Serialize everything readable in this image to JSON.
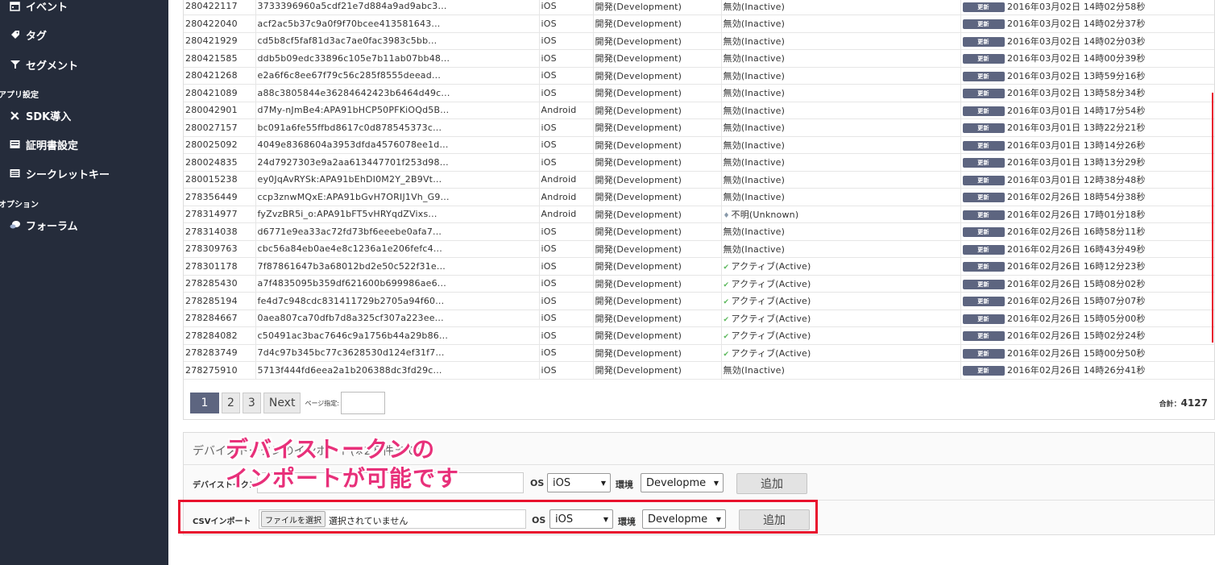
{
  "sidebar": {
    "items": [
      {
        "label": "イベント",
        "icon": "calendar-icon"
      },
      {
        "label": "タグ",
        "icon": "tag-icon"
      },
      {
        "label": "セグメント",
        "icon": "filter-icon"
      },
      {
        "label": "SDK導入",
        "icon": "tools-icon"
      },
      {
        "label": "証明書設定",
        "icon": "certificate-icon"
      },
      {
        "label": "シークレットキー",
        "icon": "key-list-icon"
      },
      {
        "label": "フォーラム",
        "icon": "forum-icon"
      }
    ],
    "sections": [
      "アプリ設定",
      "オプション"
    ]
  },
  "table": {
    "update_label": "更新",
    "rows": [
      {
        "id": "280422117",
        "token": "3733396960a5cdf21e7d884a9ad9abc3...",
        "os": "iOS",
        "env": "開発(Development)",
        "status": "無効(Inactive)",
        "status_type": "inactive",
        "date": "2016年03月02日 14時02分58秒"
      },
      {
        "id": "280422040",
        "token": "acf2ac5b37c9a0f9f70bcee413581643...",
        "os": "iOS",
        "env": "開発(Development)",
        "status": "無効(Inactive)",
        "status_type": "inactive",
        "date": "2016年03月02日 14時02分37秒"
      },
      {
        "id": "280421929",
        "token": "cd5b8cf5faf81d3ac7ae0fac3983c5bb...",
        "os": "iOS",
        "env": "開発(Development)",
        "status": "無効(Inactive)",
        "status_type": "inactive",
        "date": "2016年03月02日 14時02分03秒"
      },
      {
        "id": "280421585",
        "token": "ddb5b09edc33896c105e7b11ab07bb48...",
        "os": "iOS",
        "env": "開発(Development)",
        "status": "無効(Inactive)",
        "status_type": "inactive",
        "date": "2016年03月02日 14時00分39秒"
      },
      {
        "id": "280421268",
        "token": "e2a6f6c8ee67f79c56c285f8555deead...",
        "os": "iOS",
        "env": "開発(Development)",
        "status": "無効(Inactive)",
        "status_type": "inactive",
        "date": "2016年03月02日 13時59分16秒"
      },
      {
        "id": "280421089",
        "token": "a88c3805844e36284642423b6464d49c...",
        "os": "iOS",
        "env": "開発(Development)",
        "status": "無効(Inactive)",
        "status_type": "inactive",
        "date": "2016年03月02日 13時58分34秒"
      },
      {
        "id": "280042901",
        "token": "d7My-nJmBe4:APA91bHCP50PFKiOQd5B...",
        "os": "Android",
        "env": "開発(Development)",
        "status": "無効(Inactive)",
        "status_type": "inactive",
        "date": "2016年03月01日 14時17分54秒"
      },
      {
        "id": "280027157",
        "token": "bc091a6fe55ffbd8617c0d878545373c...",
        "os": "iOS",
        "env": "開発(Development)",
        "status": "無効(Inactive)",
        "status_type": "inactive",
        "date": "2016年03月01日 13時22分21秒"
      },
      {
        "id": "280025092",
        "token": "4049e8368604a3953dfda4576078ee1d...",
        "os": "iOS",
        "env": "開発(Development)",
        "status": "無効(Inactive)",
        "status_type": "inactive",
        "date": "2016年03月01日 13時14分26秒"
      },
      {
        "id": "280024835",
        "token": "24d7927303e9a2aa613447701f253d98...",
        "os": "iOS",
        "env": "開発(Development)",
        "status": "無効(Inactive)",
        "status_type": "inactive",
        "date": "2016年03月01日 13時13分29秒"
      },
      {
        "id": "280015238",
        "token": "ey0JqAvRYSk:APA91bEhDI0M2Y_2B9Vt...",
        "os": "Android",
        "env": "開発(Development)",
        "status": "無効(Inactive)",
        "status_type": "inactive",
        "date": "2016年03月01日 12時38分48秒"
      },
      {
        "id": "278356449",
        "token": "ccp3znwMQxE:APA91bGvH7ORIJ1Vh_G9...",
        "os": "Android",
        "env": "開発(Development)",
        "status": "無効(Inactive)",
        "status_type": "inactive",
        "date": "2016年02月26日 18時54分38秒"
      },
      {
        "id": "278314977",
        "token": "fyZvzBR5i_o:APA91bFT5vHRYqdZVixs...",
        "os": "Android",
        "env": "開発(Development)",
        "status": "不明(Unknown)",
        "status_type": "unknown",
        "date": "2016年02月26日 17時01分18秒"
      },
      {
        "id": "278314038",
        "token": "d6771e9ea33ac72fd73bf6eeebe0afa7...",
        "os": "iOS",
        "env": "開発(Development)",
        "status": "無効(Inactive)",
        "status_type": "inactive",
        "date": "2016年02月26日 16時58分11秒"
      },
      {
        "id": "278309763",
        "token": "cbc56a84eb0ae4e8c1236a1e206fefc4...",
        "os": "iOS",
        "env": "開発(Development)",
        "status": "無効(Inactive)",
        "status_type": "inactive",
        "date": "2016年02月26日 16時43分49秒"
      },
      {
        "id": "278301178",
        "token": "7f87861647b3a68012bd2e50c522f31e...",
        "os": "iOS",
        "env": "開発(Development)",
        "status": "アクティブ(Active)",
        "status_type": "active",
        "date": "2016年02月26日 16時12分23秒"
      },
      {
        "id": "278285430",
        "token": "a7f4835095b359df621600b699986ae6...",
        "os": "iOS",
        "env": "開発(Development)",
        "status": "アクティブ(Active)",
        "status_type": "active",
        "date": "2016年02月26日 15時08分02秒"
      },
      {
        "id": "278285194",
        "token": "fe4d7c948cdc831411729b2705a94f60...",
        "os": "iOS",
        "env": "開発(Development)",
        "status": "アクティブ(Active)",
        "status_type": "active",
        "date": "2016年02月26日 15時07分07秒"
      },
      {
        "id": "278284667",
        "token": "0aea807ca70dfb7d8a325cf307a223ee...",
        "os": "iOS",
        "env": "開発(Development)",
        "status": "アクティブ(Active)",
        "status_type": "active",
        "date": "2016年02月26日 15時05分00秒"
      },
      {
        "id": "278284082",
        "token": "c50491ac3bac7646c9a1756b44a29b86...",
        "os": "iOS",
        "env": "開発(Development)",
        "status": "アクティブ(Active)",
        "status_type": "active",
        "date": "2016年02月26日 15時02分24秒"
      },
      {
        "id": "278283749",
        "token": "7d4c97b345bc77c3628530d124ef31f7...",
        "os": "iOS",
        "env": "開発(Development)",
        "status": "アクティブ(Active)",
        "status_type": "active",
        "date": "2016年02月26日 15時00分50秒"
      },
      {
        "id": "278275910",
        "token": "5713f444fd6eea2a1b206388dc3fd29c...",
        "os": "iOS",
        "env": "開発(Development)",
        "status": "無効(Inactive)",
        "status_type": "inactive",
        "date": "2016年02月26日 14時26分41秒"
      }
    ]
  },
  "pagination": {
    "pages": [
      "1",
      "2",
      "3"
    ],
    "active_page": "1",
    "next_label": "Next",
    "page_jump_label": "ページ指定:",
    "total_label": "合計：",
    "total_value": "4127"
  },
  "import_panel": {
    "title": "デバイストークンのインポート(※2万件まで)",
    "token_row": {
      "label": "デバイストークン",
      "os_label": "OS",
      "os_value": "iOS",
      "env_label": "環境",
      "env_value": "Developme",
      "add_label": "追加"
    },
    "csv_row": {
      "label": "CSVインポート",
      "file_button": "ファイルを選択",
      "file_status": "選択されていません",
      "os_label": "OS",
      "os_value": "iOS",
      "env_label": "環境",
      "env_value": "Developme",
      "add_label": "追加"
    }
  },
  "annotation": {
    "line1": "デバイストークンの",
    "line2": "インポートが可能です",
    "color": "#e8307a",
    "box_color": "#e8102d"
  },
  "colors": {
    "sidebar_bg": "#252c3b",
    "accent": "#5d6580",
    "active_check": "#5cb85c"
  }
}
